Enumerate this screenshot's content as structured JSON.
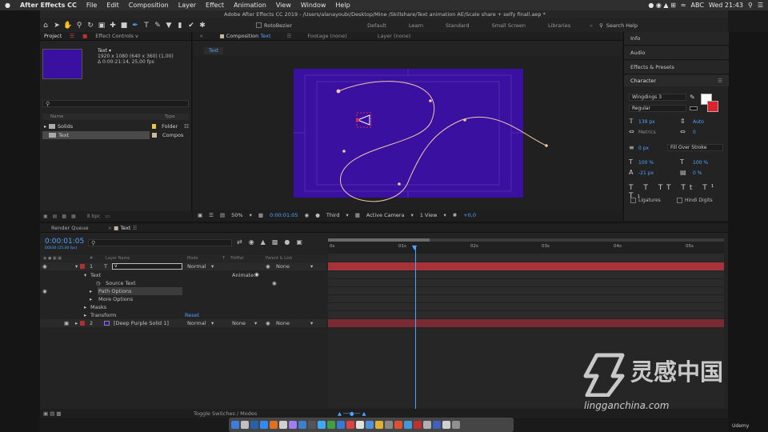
{
  "menubar": {
    "app": "After Effects CC",
    "items": [
      "File",
      "Edit",
      "Composition",
      "Layer",
      "Effect",
      "Animation",
      "View",
      "Window",
      "Help"
    ],
    "input_source": "ABC",
    "clock": "Wed 21:43"
  },
  "window_title": "Adobe After Effects CC 2019 - /Users/alanayoubi/Desktop/Mine /Skillshare/Text animation AE/Scale share + selfy finall.aep *",
  "toolbar": {
    "rotobezier": "RotoBezier",
    "workspaces": [
      "Default",
      "Learn",
      "Standard",
      "Small Screen",
      "Libraries"
    ],
    "search_help": "Search Help"
  },
  "project": {
    "tab_project": "Project",
    "tab_effect": "Effect Controls v",
    "selected_name": "Text ▾",
    "selected_info": [
      "1920 x 1080  (640 x 360) (1,00)",
      "Δ 0:00:21:14, 25,00 fps"
    ],
    "col_name": "Name",
    "col_type": "Type",
    "items": [
      {
        "name": "Solids",
        "type": "Folder",
        "color": "#e8c840"
      },
      {
        "name": "Text",
        "type": "Compos",
        "color": "#c7b99a"
      }
    ],
    "bpc": "8 bpc"
  },
  "composition": {
    "tab_comp": "Composition",
    "comp_name": "Text",
    "tab_footage": "Footage (none)",
    "tab_layer": "Layer (none)",
    "breadcrumb": "Text",
    "zoom": "50%",
    "time": "0:00:01:05",
    "resolution": "Third",
    "camera": "Active Camera",
    "views": "1 View",
    "exposure": "+0,0",
    "bg_color": "#3a10a0",
    "path_color": "#f0c8a8"
  },
  "right_panel": {
    "info": "Info",
    "audio": "Audio",
    "effects": "Effects & Presets",
    "character": "Character",
    "font": "Wingdings 3",
    "style": "Regular",
    "size": "139 px",
    "leading": "Auto",
    "kerning": "Metrics",
    "tracking": "0",
    "stroke_width": "0 px",
    "stroke_type": "Fill Over Stroke",
    "vscale": "100 %",
    "hscale": "100 %",
    "baseline": "-21 px",
    "tsume": "0 %",
    "ligatures": "Ligatures",
    "hindi": "Hindi Digits"
  },
  "timeline": {
    "tab_render": "Render Queue",
    "tab_comp": "Text",
    "timecode": "0:00:01:05",
    "timecode_sub": "00030 (25.00 fps)",
    "col_layer_name": "Layer Name",
    "col_mode": "Mode",
    "col_t": "T",
    "col_trkmat": "TrkMat",
    "col_parent": "Parent & Link",
    "ruler": [
      "0s",
      "01s",
      "02s",
      "03s",
      "04s",
      "05s"
    ],
    "layers": [
      {
        "num": "1",
        "name": "v",
        "mode": "Normal",
        "parent": "None",
        "color": "#b03030"
      },
      {
        "num": "2",
        "name": "[Deep Purple Solid 1]",
        "mode": "Normal",
        "trkmat": "None",
        "parent": "None",
        "color": "#b03030"
      }
    ],
    "props": {
      "text": "Text",
      "animate": "Animate:",
      "source_text": "Source Text",
      "path_options": "Path Options",
      "more_options": "More Options",
      "masks": "Masks",
      "transform": "Transform",
      "reset": "Reset"
    },
    "toggle": "Toggle Switches / Modes",
    "track_color": "#a8323a"
  },
  "watermark": {
    "brand": "灵感中国",
    "url": "lingganchina.com"
  },
  "udemy": "Udemy"
}
